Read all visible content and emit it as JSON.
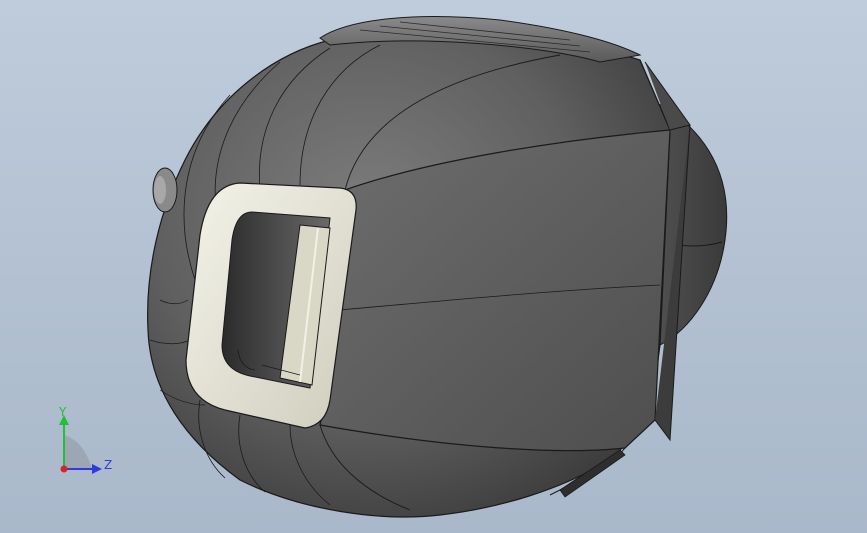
{
  "viewport": {
    "background_top": "#bfccdb",
    "background_bottom": "#a9b8ca"
  },
  "model": {
    "body_color": "#6b6b6b",
    "body_dark": "#3f3f3f",
    "edge_color": "#1a1a1a",
    "handle_color": "#ecebe0"
  },
  "triad": {
    "y_label": "Y",
    "z_label": "Z",
    "y_color": "#22c03a",
    "z_color": "#2f3bdc",
    "origin_color": "#d8232a"
  }
}
